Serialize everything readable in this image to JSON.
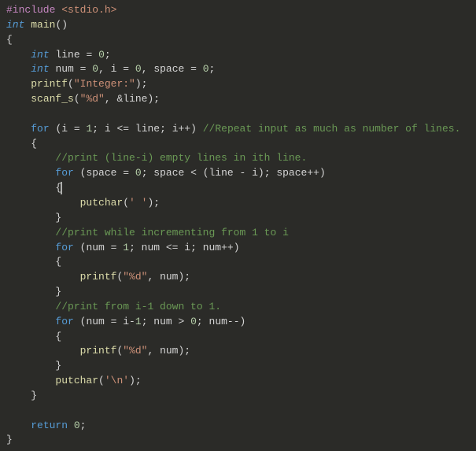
{
  "code": {
    "include_kw": "#include",
    "include_hdr": "<stdio.h>",
    "int_kw": "int",
    "main_fn": "main",
    "lbrace": "{",
    "rbrace": "}",
    "line_decl_a": "line",
    "line_decl_b": " = ",
    "zero": "0",
    "one": "1",
    "semicolon": ";",
    "num_id": "num",
    "i_id": "i",
    "space_id": "space",
    "printf_fn": "printf",
    "scanf_fn": "scanf_s",
    "putchar_fn": "putchar",
    "str_integer": "\"Integer:\"",
    "str_pd": "\"%d\"",
    "amp_line": "&line",
    "for_kw": "for",
    "return_kw": "return",
    "com_repeat": "//Repeat input as much as number of lines.",
    "com_print_empty": "//print (line-i) empty lines in ith line.",
    "com_print_inc": "//print while incrementing from 1 to i",
    "com_print_dec": "//print from i-1 down to 1.",
    "char_space": "' '",
    "char_nl": "'\\n'",
    "for1_init": "i = ",
    "for1_cond": "; i <= line; i++",
    "for2_init": "space = ",
    "for2_cond": "; space < (line - i); space++",
    "for3_init": "num = ",
    "for3_cond": "; num <= i; num++",
    "for4_init": "num = i-",
    "for4_cond": "; num > ",
    "for4_post": "; num--",
    "paren_open": "(",
    "paren_close": ")",
    "comma_sp": ", ",
    "eq_sp": " = "
  }
}
